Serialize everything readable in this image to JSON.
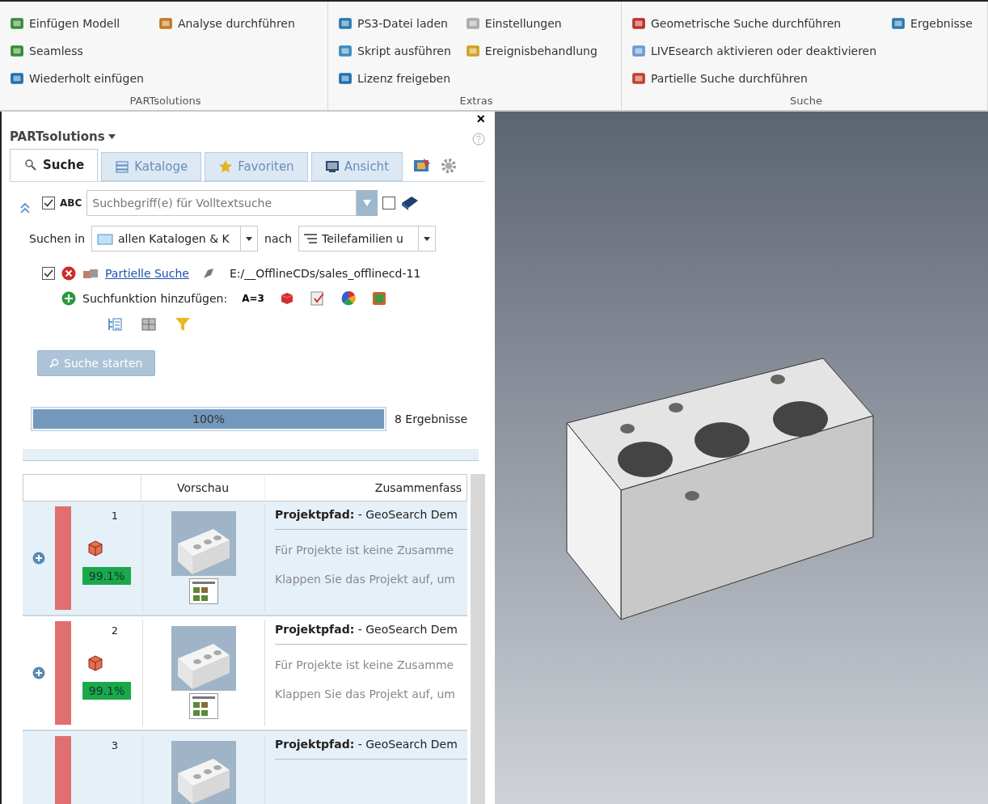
{
  "ribbon": {
    "groups": [
      {
        "label": "PARTsolutions",
        "columns": [
          [
            {
              "label": "Einfügen Modell"
            },
            {
              "label": "Seamless"
            },
            {
              "label": "Wiederholt einfügen"
            }
          ],
          [
            {
              "label": "Analyse durchführen"
            }
          ]
        ]
      },
      {
        "label": "Extras",
        "columns": [
          [
            {
              "label": "PS3-Datei laden"
            },
            {
              "label": "Skript ausführen"
            },
            {
              "label": "Lizenz freigeben"
            }
          ],
          [
            {
              "label": "Einstellungen"
            },
            {
              "label": "Ereignisbehandlung"
            }
          ]
        ]
      },
      {
        "label": "Suche",
        "columns": [
          [
            {
              "label": "Geometrische Suche durchführen"
            },
            {
              "label": "LIVEsearch aktivieren oder deaktivieren"
            },
            {
              "label": "Partielle Suche durchführen"
            }
          ],
          [
            {
              "label": "Ergebnisse"
            }
          ]
        ]
      }
    ]
  },
  "panel": {
    "title": "PARTsolutions",
    "close": "×",
    "tabs": [
      {
        "label": "Suche",
        "selected": true
      },
      {
        "label": "Kataloge",
        "selected": false
      },
      {
        "label": "Favoriten",
        "selected": false
      },
      {
        "label": "Ansicht",
        "selected": false
      }
    ],
    "fulltext": {
      "checked": true,
      "tag": "ABC",
      "placeholder": "Suchbegriff(e) für Volltextsuche",
      "option_checked": false
    },
    "scope": {
      "label": "Suchen in",
      "value": "allen Katalogen & K",
      "by_label": "nach",
      "by_value": "Teilefamilien u"
    },
    "filter": {
      "checked": true,
      "link": "Partielle Suche",
      "path": "E:/__OfflineCDs/sales_offlinecd-11"
    },
    "add_function": {
      "label": "Suchfunktion hinzufügen:",
      "equals_tool": "A=3"
    },
    "start_button": {
      "label": "Suche starten",
      "disabled": true
    },
    "progress": {
      "level": 1,
      "text": "100%",
      "count": "8 Ergebnisse"
    },
    "table": {
      "columns": [
        "Vorschau",
        "Zusammenfass"
      ],
      "rows": [
        {
          "number": "1",
          "match": "99.1%",
          "title": "**Projektpfad:** - GeoSearch Dem",
          "description": [
            "Für Projekte ist keine Zusamme",
            "Klappen Sie das Projekt auf, um"
          ]
        },
        {
          "number": "2",
          "match": "99.1%",
          "title": "**Projektpfad:** - GeoSearch Dem",
          "description": [
            "Für Projekte ist keine Zusamme",
            "Klappen Sie das Projekt auf, um"
          ]
        },
        {
          "number": "3",
          "title": "**Projektpfad:** - GeoSearch Dem"
        }
      ]
    }
  }
}
